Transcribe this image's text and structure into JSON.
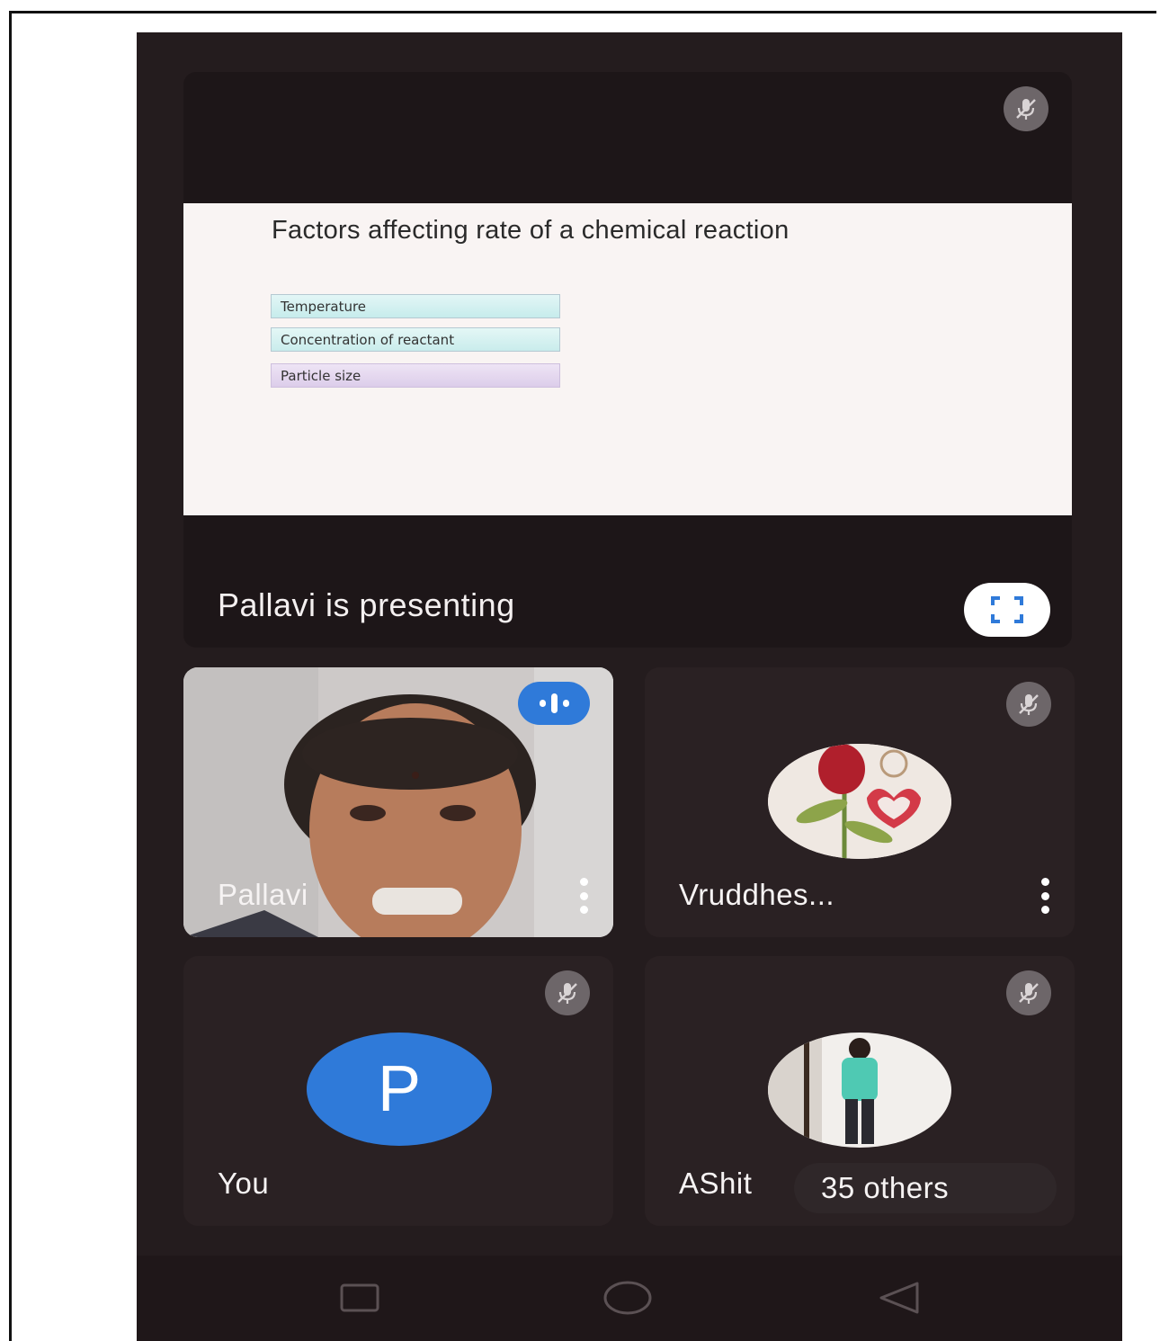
{
  "stage": {
    "slide": {
      "title": "Factors affecting rate of a chemical reaction",
      "items": [
        "Temperature",
        "Concentration of reactant",
        "Particle size"
      ]
    },
    "presenting_text": "Pallavi is presenting",
    "mic_state": "muted",
    "fullscreen_icon": "fullscreen-icon"
  },
  "tiles": [
    {
      "name": "Pallavi",
      "mic_state": "speaking",
      "media": "camera-video"
    },
    {
      "name": "Vruddhes...",
      "mic_state": "muted",
      "media": "profile-photo-rose"
    },
    {
      "name": "You",
      "mic_state": "muted",
      "avatar_letter": "P",
      "avatar_color": "#2f7ad9"
    },
    {
      "name": "AShit",
      "mic_state": "muted",
      "media": "profile-photo-person",
      "others_label": "35 others"
    }
  ],
  "navbar": {
    "icons": [
      "recent-apps-icon",
      "home-icon",
      "back-icon"
    ]
  },
  "colors": {
    "accent_blue": "#2f7ad9",
    "background": "#241c1e",
    "tile": "#2a2123"
  }
}
